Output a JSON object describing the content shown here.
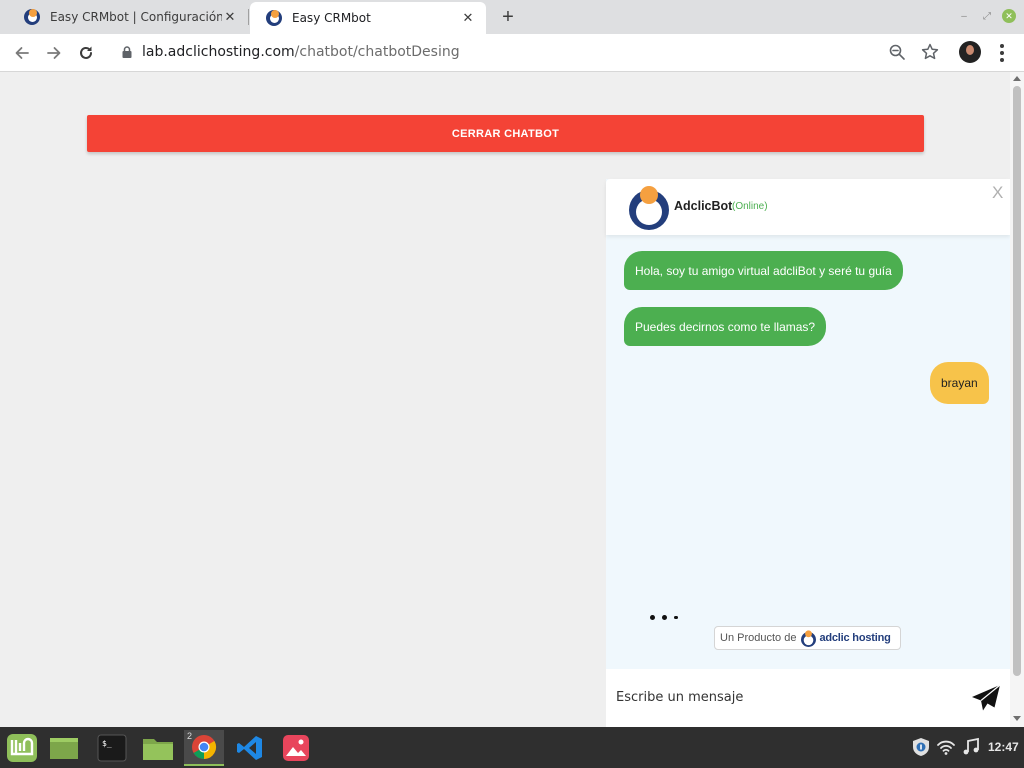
{
  "browser": {
    "tabs": [
      {
        "title": "Easy CRMbot | Configuración",
        "active": false
      },
      {
        "title": "Easy CRMbot",
        "active": true
      }
    ],
    "url_host": "lab.adclichosting.com",
    "url_path": "/chatbot/chatbotDesing"
  },
  "page": {
    "close_button_label": "CERRAR CHATBOT"
  },
  "chatbot": {
    "bot_name": "AdclicBot",
    "status": "(Online)",
    "close_label": "X",
    "messages": [
      {
        "from": "bot",
        "text": "Hola, soy tu amigo virtual adcliBot y seré tu guía"
      },
      {
        "from": "bot",
        "text": "Puedes decirnos como te llamas?"
      },
      {
        "from": "user",
        "text": "brayan"
      }
    ],
    "powered_by_prefix": "Un Producto de",
    "powered_by_brand_a": "adclic",
    "powered_by_brand_b": " hosting",
    "input_placeholder": "Escribe un mensaje"
  },
  "taskbar": {
    "chrome_badge": "2",
    "clock": "12:47"
  },
  "colors": {
    "close_button": "#f44336",
    "bot_bubble": "#4caf50",
    "user_bubble": "#f7c34a",
    "status_online": "#4caf50",
    "brand_blue": "#233e7c",
    "brand_orange": "#f5a040"
  }
}
